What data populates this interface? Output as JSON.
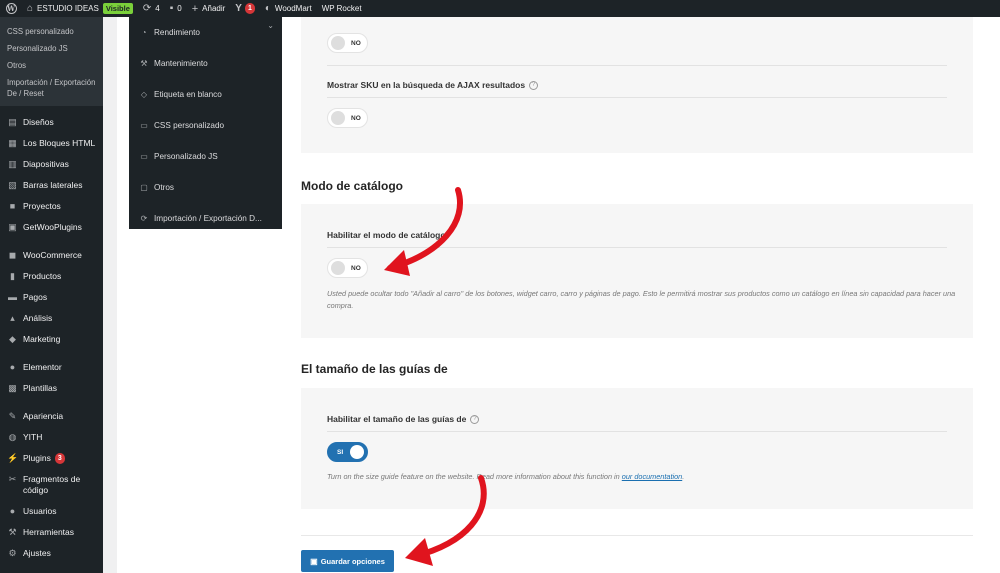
{
  "adminbar": {
    "site_name": "ESTUDIO IDEAS",
    "visible_badge": "Visible",
    "updates_count": "4",
    "comments_count": "0",
    "new_label": "Añadir",
    "yoast_count": "1",
    "woodmart_label": "WoodMart",
    "wprocket_label": "WP Rocket"
  },
  "sidebar": {
    "submenu": [
      "CSS personalizado",
      "Personalizado JS",
      "Otros",
      "Importación / Exportación De / Reset"
    ],
    "items": [
      {
        "label": "Diseños",
        "icon": "layout-icon"
      },
      {
        "label": "Los Bloques HTML",
        "icon": "blocks-icon"
      },
      {
        "label": "Diapositivas",
        "icon": "slides-icon"
      },
      {
        "label": "Barras laterales",
        "icon": "sidebar-icon"
      },
      {
        "label": "Proyectos",
        "icon": "portfolio-icon"
      },
      {
        "label": "GetWooPlugins",
        "icon": "plugin-icon"
      },
      {
        "label": "WooCommerce",
        "icon": "woocommerce-icon"
      },
      {
        "label": "Productos",
        "icon": "products-icon"
      },
      {
        "label": "Pagos",
        "icon": "payments-icon"
      },
      {
        "label": "Análisis",
        "icon": "analytics-icon"
      },
      {
        "label": "Marketing",
        "icon": "marketing-icon"
      },
      {
        "label": "Elementor",
        "icon": "elementor-icon"
      },
      {
        "label": "Plantillas",
        "icon": "templates-icon"
      },
      {
        "label": "Apariencia",
        "icon": "appearance-icon"
      },
      {
        "label": "YITH",
        "icon": "yith-icon"
      },
      {
        "label": "Plugins",
        "icon": "plugins-icon",
        "badge": "3"
      },
      {
        "label": "Fragmentos de código",
        "icon": "snippets-icon"
      },
      {
        "label": "Usuarios",
        "icon": "users-icon"
      },
      {
        "label": "Herramientas",
        "icon": "tools-icon"
      },
      {
        "label": "Ajustes",
        "icon": "settings-icon"
      }
    ]
  },
  "dropdown": {
    "items": [
      {
        "label": "Rendimiento",
        "icon": "speedometer-icon"
      },
      {
        "label": "Mantenimiento",
        "icon": "wrench-icon"
      },
      {
        "label": "Etiqueta en blanco",
        "icon": "tag-icon"
      },
      {
        "label": "CSS personalizado",
        "icon": "css-icon"
      },
      {
        "label": "Personalizado JS",
        "icon": "js-icon"
      },
      {
        "label": "Otros",
        "icon": "other-icon"
      },
      {
        "label": "Importación / Exportación D...",
        "icon": "import-export-icon"
      }
    ]
  },
  "settings": {
    "top_toggle_state": "NO",
    "sku_label": "Mostrar SKU en la búsqueda de AJAX resultados",
    "sku_toggle_state": "NO",
    "catalog_section_title": "Modo de catálogo",
    "catalog_label": "Habilitar el modo de catálogo",
    "catalog_toggle_state": "NO",
    "catalog_desc": "Usted puede ocultar todo \"Añadir al carro\" de los botones, widget carro, carro y páginas de pago. Esto le permitirá mostrar sus productos como un catálogo en línea sin capacidad para hacer una compra.",
    "size_section_title": "El tamaño de las guías de",
    "size_label": "Habilitar el tamaño de las guías de",
    "size_toggle_state": "SI",
    "size_desc_prefix": "Turn on the size guide feature on the website. Read more information about this function in ",
    "size_desc_link": "our documentation",
    "size_desc_suffix": ".",
    "save_label": "Guardar opciones"
  },
  "colors": {
    "accent": "#2271b1",
    "arrow": "#e0141e",
    "admin_dark": "#1d2327"
  }
}
